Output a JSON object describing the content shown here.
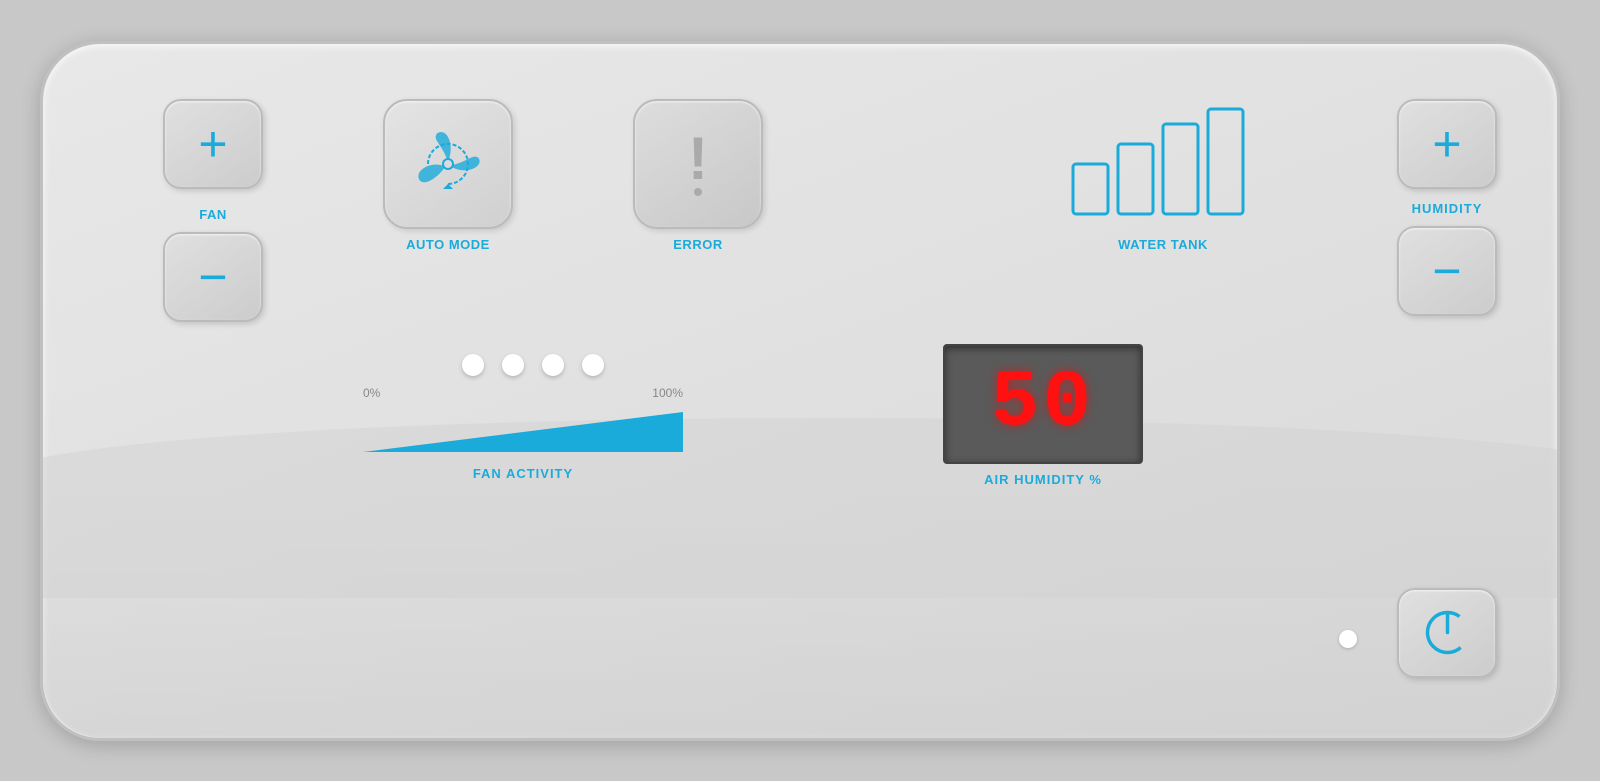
{
  "panel": {
    "fan": {
      "label": "FAN",
      "plus_label": "+",
      "minus_label": "−"
    },
    "auto_mode": {
      "label": "AUTO MODE"
    },
    "error": {
      "label": "ERROR"
    },
    "water_tank": {
      "label": "WATER TANK"
    },
    "fan_activity": {
      "label": "FAN ACTIVITY",
      "percent_low": "0%",
      "percent_high": "100%"
    },
    "air_humidity": {
      "value": "50",
      "label": "AIR HUMIDITY %"
    },
    "humidity": {
      "label": "HUMIDITY",
      "plus_label": "+",
      "minus_label": "−"
    },
    "power": {
      "label": "POWER"
    }
  }
}
